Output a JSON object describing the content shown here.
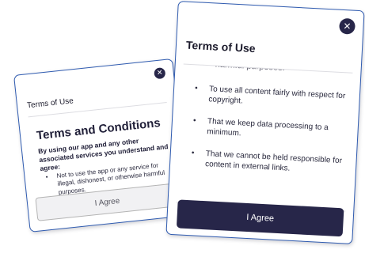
{
  "back_card": {
    "header_title": "Terms of Use",
    "close_glyph": "✕",
    "body_heading": "Terms and Conditions",
    "intro": "By using our app and any other associated services you understand and agree:",
    "list": [
      "Not to use the app or any service for illegal, dishonest, or otherwise harmful purposes."
    ],
    "button_label": "I Agree"
  },
  "front_card": {
    "header_title": "Terms of Use",
    "close_glyph": "✕",
    "cut_off_text": "harmful purposes.",
    "list": [
      "To use all content fairly with respect for copyright.",
      "That we keep data processing to a minimum.",
      "That we cannot be held responsible for content in external links."
    ],
    "button_label": "I Agree"
  },
  "colors": {
    "primary": "#272649",
    "card_border": "#2f5bb0",
    "secondary_button_bg": "#f1f1f3",
    "text": "#2a2a3e"
  },
  "icons": {
    "close": "close-icon"
  }
}
